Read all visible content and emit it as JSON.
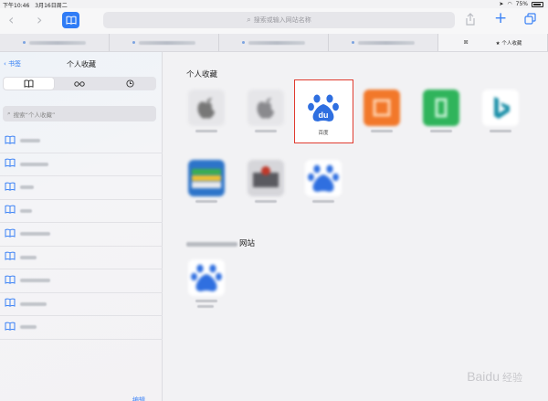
{
  "status": {
    "time_date": "下午10:46　3月16日周二",
    "battery": "75%"
  },
  "toolbar": {
    "back_icon": "chevron-left-icon",
    "forward_icon": "chevron-right-icon",
    "search_placeholder": "搜索或输入网站名称",
    "share_icon": "share-icon",
    "add_icon": "plus-icon",
    "tabs_icon": "tabs-icon"
  },
  "tabs": [
    {
      "title": "",
      "active": false
    },
    {
      "title": "",
      "active": false
    },
    {
      "title": "",
      "active": false
    },
    {
      "title": "",
      "active": false
    },
    {
      "title": "★ 个人收藏",
      "active": true
    }
  ],
  "sidebar": {
    "back_label": "‹ 书签",
    "title": "个人收藏",
    "segments": [
      "📖",
      "∞",
      "🕘"
    ],
    "search_placeholder": "搜索“个人收藏”",
    "items": [
      {
        "width": 20
      },
      {
        "width": 28
      },
      {
        "width": 14
      },
      {
        "width": 12
      },
      {
        "width": 30
      },
      {
        "width": 16
      },
      {
        "width": 30
      },
      {
        "width": 26
      },
      {
        "width": 16
      }
    ],
    "edit_label": "编辑"
  },
  "main": {
    "favorites_title": "个人收藏",
    "favorites": [
      {
        "label": "",
        "color": "#d9d9dc",
        "kind": "apple"
      },
      {
        "label": "",
        "color": "#d9d9dc",
        "kind": "apple"
      },
      {
        "label": "百度",
        "color": "#ffffff",
        "kind": "baidu"
      },
      {
        "label": "",
        "color": "#f07a28",
        "kind": "orange"
      },
      {
        "label": "",
        "color": "#2eb35a",
        "kind": "green"
      },
      {
        "label": "",
        "color": "#ffffff",
        "kind": "bing"
      },
      {
        "label": "",
        "color": "#3a7fd0",
        "kind": "wallet"
      },
      {
        "label": "",
        "color": "#8d8d92",
        "kind": "news"
      },
      {
        "label": "",
        "color": "#ffffff",
        "kind": "baidu-blur"
      }
    ],
    "frequent_title": "网站",
    "frequent": [
      {
        "label": "",
        "kind": "baidu-blur"
      }
    ]
  },
  "watermark": {
    "brand": "Baidu",
    "sub": "经验"
  }
}
